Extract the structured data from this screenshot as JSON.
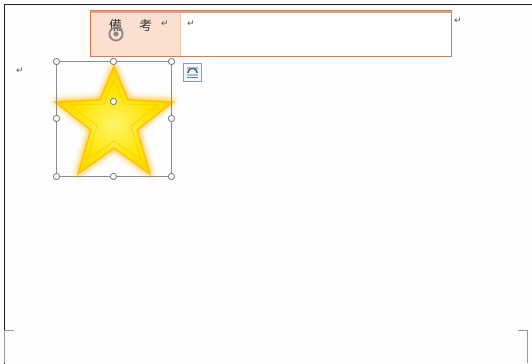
{
  "table": {
    "label": "備　 考",
    "label_mark": "↵",
    "content_mark": "↵",
    "end_mark": "↵"
  },
  "body": {
    "paragraph_mark": "↵"
  },
  "shape": {
    "type": "star",
    "fill_color": "#ffe600",
    "glow_color": "#ffb300"
  },
  "icons": {
    "rotate": "rotate-handle-icon",
    "layout_options": "layout-options-icon"
  }
}
